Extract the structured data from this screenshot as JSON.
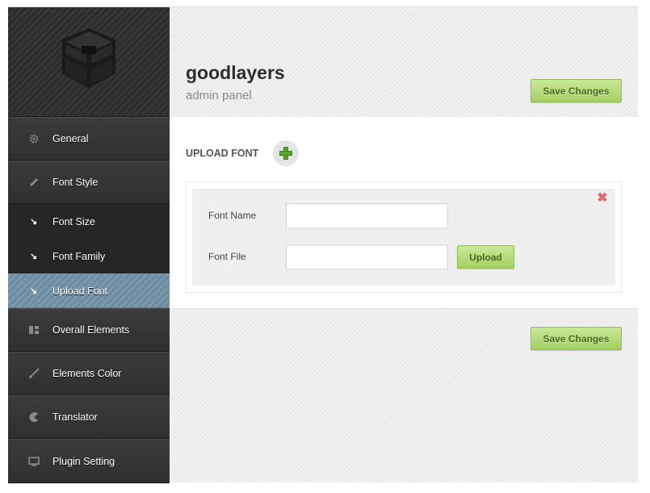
{
  "brand": {
    "title": "goodlayers",
    "subtitle": "admin panel"
  },
  "actions": {
    "save_label": "Save Changes"
  },
  "sidebar": {
    "items": [
      {
        "label": "General",
        "icon": "gear-icon"
      },
      {
        "label": "Font Style",
        "icon": "pencil-icon"
      },
      {
        "label": "Font Size",
        "icon": "arrow-down-right-icon"
      },
      {
        "label": "Font Family",
        "icon": "arrow-down-right-icon"
      },
      {
        "label": "Upload Font",
        "icon": "arrow-down-right-icon",
        "active": true
      },
      {
        "label": "Overall Elements",
        "icon": "layout-icon"
      },
      {
        "label": "Elements Color",
        "icon": "brush-icon"
      },
      {
        "label": "Translator",
        "icon": "pacman-icon"
      },
      {
        "label": "Plugin Setting",
        "icon": "monitor-icon"
      }
    ]
  },
  "main": {
    "section_title": "UPLOAD FONT",
    "font_name_label": "Font Name",
    "font_name_value": "",
    "font_file_label": "Font File",
    "font_file_value": "",
    "upload_label": "Upload"
  },
  "colors": {
    "accent_green": "#a4d162",
    "active_item": "#6f8fa6",
    "sidebar_bg": "#2c2c2c",
    "remove_red": "#e06a6a"
  }
}
